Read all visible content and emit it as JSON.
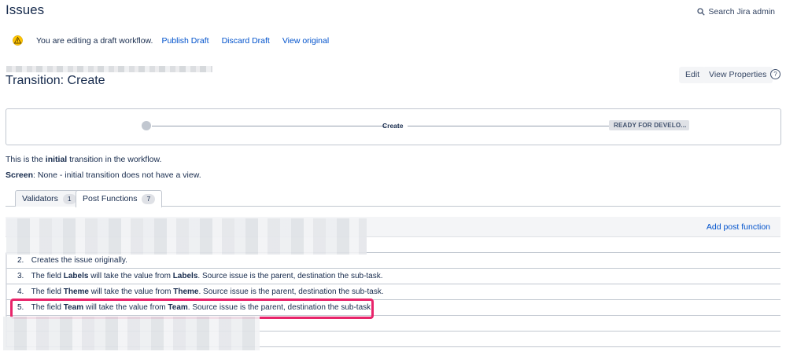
{
  "header": {
    "title": "Issues",
    "search_label": "Search Jira admin"
  },
  "banner": {
    "message": "You are editing a draft workflow.",
    "publish": "Publish Draft",
    "discard": "Discard Draft",
    "view_original": "View original"
  },
  "transition": {
    "title": "Transition: Create",
    "edit": "Edit",
    "view_properties": "View Properties",
    "help": "?"
  },
  "diagram": {
    "transition_label": "Create",
    "target_status": "READY FOR DEVELO..."
  },
  "info": {
    "line1_pre": "This is the ",
    "line1_bold": "initial",
    "line1_post": " transition in the workflow.",
    "line2_bold": "Screen",
    "line2_post": ": None - initial transition does not have a view."
  },
  "tabs": [
    {
      "label": "Validators",
      "count": "1"
    },
    {
      "label": "Post Functions",
      "count": "7"
    }
  ],
  "table": {
    "add_post_function": "Add post function",
    "rows": [
      {
        "num": "2.",
        "parts": [
          "Creates the issue originally."
        ]
      },
      {
        "num": "3.",
        "pre": "The field ",
        "field": "Labels",
        "mid": " will take the value from ",
        "src": "Labels",
        "post": ". Source issue is the parent, destination the sub-task."
      },
      {
        "num": "4.",
        "pre": "The field ",
        "field": "Theme",
        "mid": " will take the value from ",
        "src": "Theme",
        "post": ". Source issue is the parent, destination the sub-task."
      },
      {
        "num": "5.",
        "pre": "The field ",
        "field": "Team",
        "mid": " will take the value from ",
        "src": "Team",
        "post": ". Source issue is the parent, destination the sub-task."
      }
    ]
  },
  "colors": {
    "link": "#0052cc",
    "highlight": "#e8246a",
    "text": "#172b4d"
  }
}
